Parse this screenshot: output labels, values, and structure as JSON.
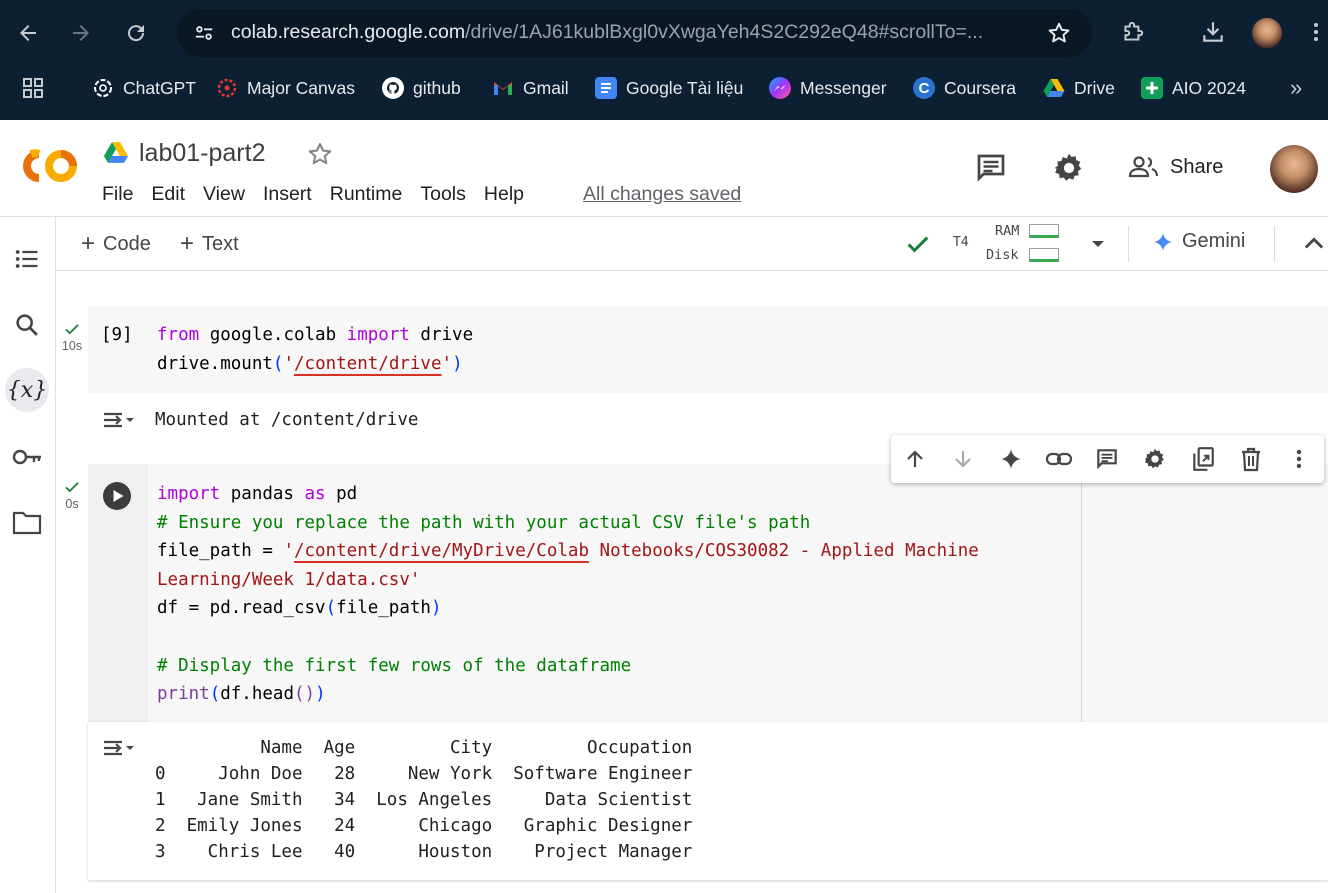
{
  "browser": {
    "url_host": "colab.research.google.com",
    "url_path": "/drive/1AJ61kublBxgl0vXwgaYeh4S2C292eQ48#scrollTo=...",
    "bookmarks": [
      {
        "label": "ChatGPT",
        "icon": "chatgpt-icon"
      },
      {
        "label": "Major Canvas",
        "icon": "canvas-icon"
      },
      {
        "label": "github",
        "icon": "github-icon"
      },
      {
        "label": "Gmail",
        "icon": "gmail-icon"
      },
      {
        "label": "Google Tài liệu",
        "icon": "google-docs-icon"
      },
      {
        "label": "Messenger",
        "icon": "messenger-icon"
      },
      {
        "label": "Coursera",
        "icon": "coursera-icon"
      },
      {
        "label": "Drive",
        "icon": "drive-icon"
      },
      {
        "label": "AIO 2024",
        "icon": "sheets-icon"
      }
    ],
    "bookmarks_overflow": "»"
  },
  "colab": {
    "logo_text": "CO",
    "notebook_title": "lab01-part2",
    "menu": [
      "File",
      "Edit",
      "View",
      "Insert",
      "Runtime",
      "Tools",
      "Help"
    ],
    "save_status": "All changes saved",
    "share_label": "Share"
  },
  "toolbar": {
    "add_code": "Code",
    "add_text": "Text",
    "runtime_type": "T4",
    "ram_label": "RAM",
    "disk_label": "Disk",
    "gemini_label": "Gemini"
  },
  "cells": [
    {
      "execution_count": "[9]",
      "exec_time": "10s",
      "code_lines": [
        [
          {
            "t": "from",
            "c": "kw"
          },
          {
            "t": " google.colab "
          },
          {
            "t": "import",
            "c": "kw"
          },
          {
            "t": " drive"
          }
        ],
        [
          {
            "t": "drive.mount"
          },
          {
            "t": "(",
            "c": "paren-b"
          },
          {
            "t": "'",
            "c": "str"
          },
          {
            "t": "/content/drive",
            "c": "str squiggle"
          },
          {
            "t": "'",
            "c": "str"
          },
          {
            "t": ")",
            "c": "paren-b"
          }
        ]
      ],
      "output": "Mounted at /content/drive"
    },
    {
      "exec_time": "0s",
      "code_lines": [
        [
          {
            "t": "import",
            "c": "kw"
          },
          {
            "t": " pandas "
          },
          {
            "t": "as",
            "c": "kw"
          },
          {
            "t": " pd"
          }
        ],
        [
          {
            "t": "# Ensure you replace the path with your actual CSV file's path",
            "c": "cmt"
          }
        ],
        [
          {
            "t": "file_path = "
          },
          {
            "t": "'",
            "c": "str"
          },
          {
            "t": "/content/drive/MyDrive/Colab",
            "c": "str squiggle"
          },
          {
            "t": " Notebooks/COS30082 - Applied Machine",
            "c": "str"
          }
        ],
        [
          {
            "t": "Learning/Week 1/data.csv'",
            "c": "str"
          }
        ],
        [
          {
            "t": "df = pd.read_csv"
          },
          {
            "t": "(",
            "c": "paren-b"
          },
          {
            "t": "file_path"
          },
          {
            "t": ")",
            "c": "paren-b"
          }
        ],
        [],
        [
          {
            "t": "# Display the first few rows of the dataframe",
            "c": "cmt"
          }
        ],
        [
          {
            "t": "print",
            "c": "paren-p"
          },
          {
            "t": "(",
            "c": "paren-b"
          },
          {
            "t": "df.head"
          },
          {
            "t": "()",
            "c": "paren-p"
          },
          {
            "t": ")",
            "c": "paren-b"
          }
        ]
      ],
      "output_table": {
        "columns": [
          "Name",
          "Age",
          "City",
          "Occupation"
        ],
        "rows": [
          [
            "0",
            "John Doe",
            "28",
            "New York",
            "Software Engineer"
          ],
          [
            "1",
            "Jane Smith",
            "34",
            "Los Angeles",
            "Data Scientist"
          ],
          [
            "2",
            "Emily Jones",
            "24",
            "Chicago",
            "Graphic Designer"
          ],
          [
            "3",
            "Chris Lee",
            "40",
            "Houston",
            "Project Manager"
          ]
        ]
      }
    }
  ],
  "colors": {
    "keyword": "#af00db",
    "string": "#a31515",
    "comment": "#008000",
    "success": "#188038",
    "chrome_bg": "#0d1f33"
  }
}
